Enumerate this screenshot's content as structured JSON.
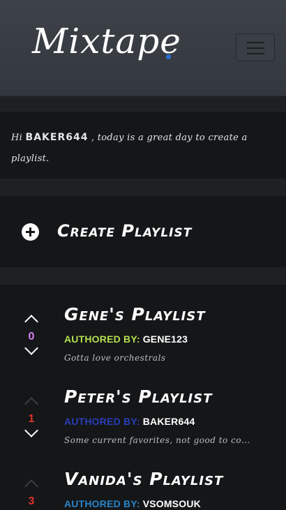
{
  "brand": {
    "name": "Mixtape"
  },
  "colors": {
    "background": "#1e2124",
    "card": "#141618",
    "navbar": "#3d4248",
    "brand_dot": "#2a6fd6"
  },
  "greeting": {
    "prefix": "Hi ",
    "username": "BAKER644",
    "suffix": " , today is a great day to create a playlist."
  },
  "create": {
    "icon": "plus-circle-icon",
    "label": "Create Playlist"
  },
  "playlists": [
    {
      "title": "Gene's Playlist",
      "author_label": "AUTHORED BY:",
      "author": "GENE123",
      "author_label_color": "#b5e04e",
      "score": "0",
      "score_color": "#d87ef2",
      "up_active": true,
      "down_active": true,
      "description": "Gotta love orchestrals"
    },
    {
      "title": "Peter's Playlist",
      "author_label": "AUTHORED BY:",
      "author": "BAKER644",
      "author_label_color": "#2a3eb8",
      "score": "1",
      "score_color": "#e0342c",
      "up_active": false,
      "down_active": true,
      "description": "Some current favorites, not good to co..."
    },
    {
      "title": "Vanida's Playlist",
      "author_label": "AUTHORED BY:",
      "author": "VSOMSOUK",
      "author_label_color": "#2a85c9",
      "score": "3",
      "score_color": "#e0342c",
      "up_active": false,
      "down_active": true,
      "description": ""
    }
  ]
}
